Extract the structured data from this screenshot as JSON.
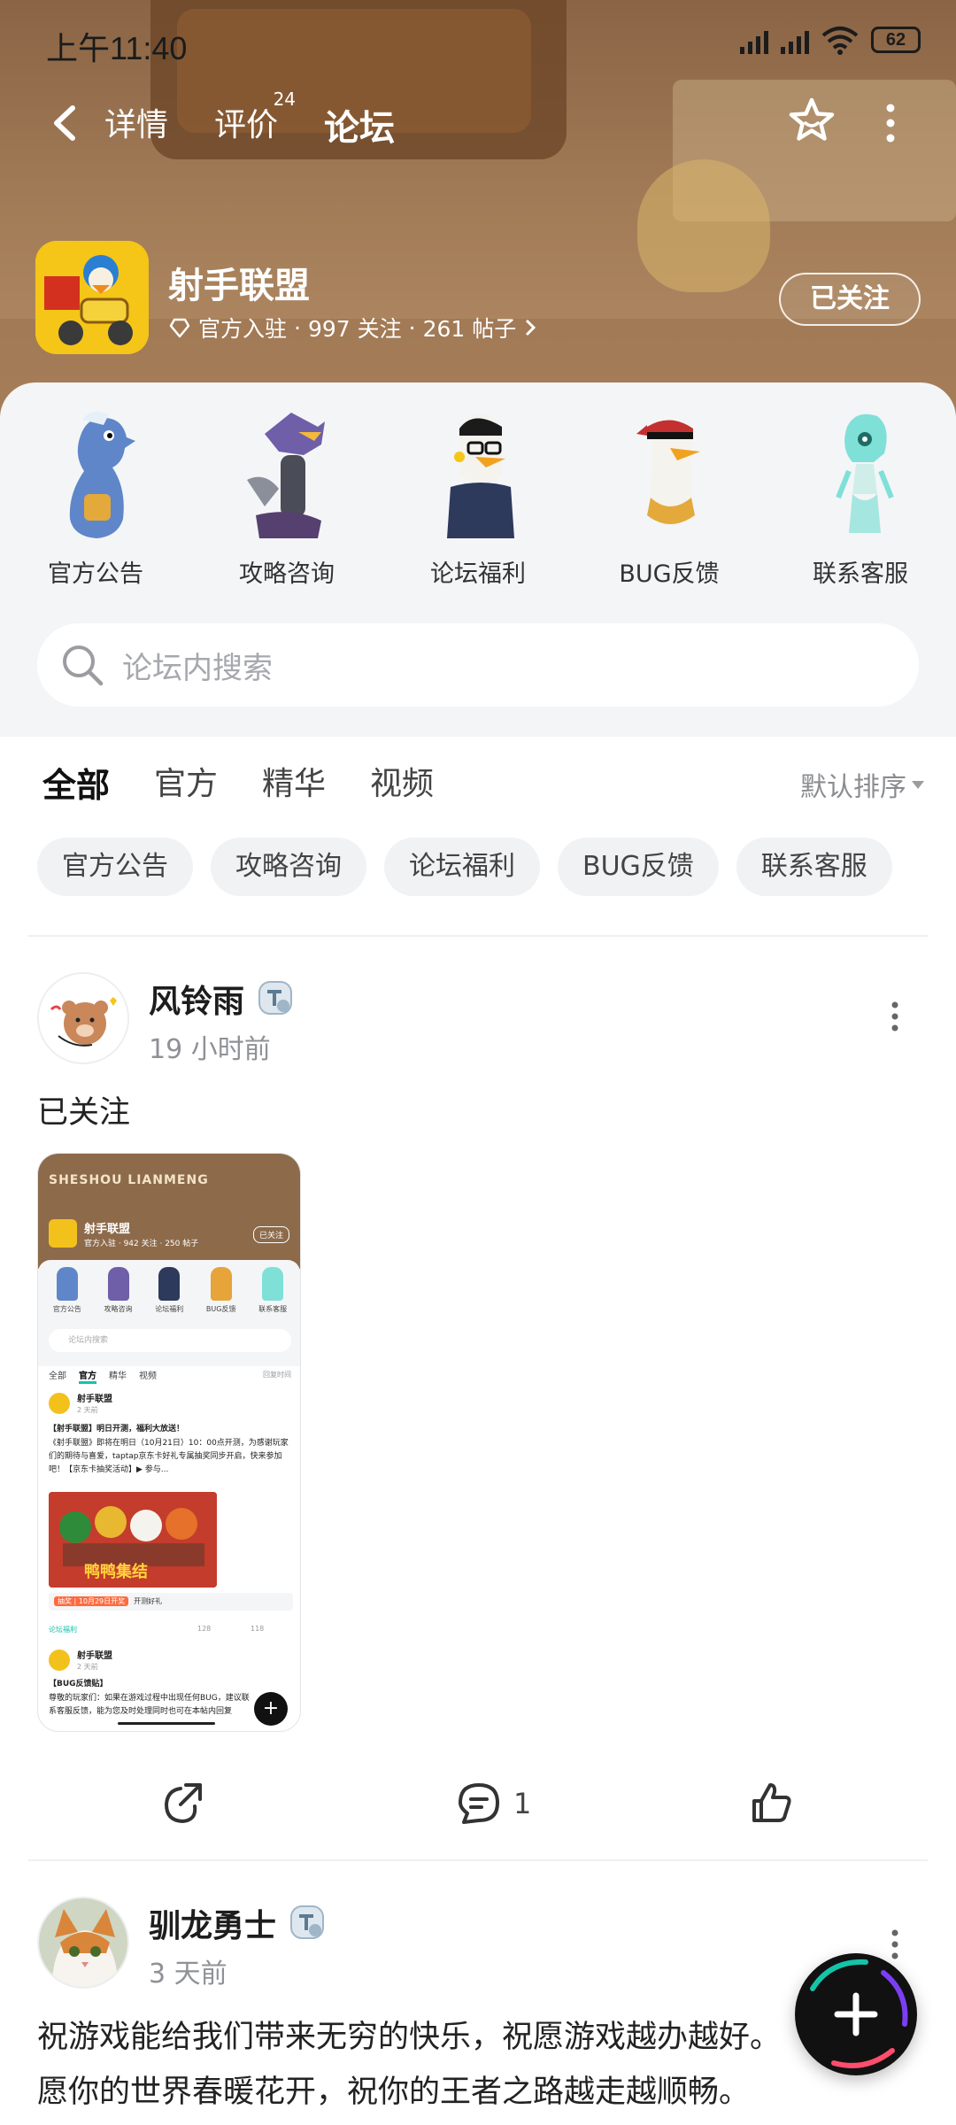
{
  "status_bar": {
    "time": "上午11:40",
    "battery": "62"
  },
  "nav": {
    "tabs": [
      {
        "label": "详情"
      },
      {
        "label": "评价",
        "badge": "24"
      },
      {
        "label": "论坛"
      }
    ],
    "active_tab": "论坛"
  },
  "app": {
    "name": "射手联盟",
    "meta_official": "官方入驻",
    "meta_followers": "997 关注",
    "meta_posts": "261 帖子",
    "separator": "·",
    "follow_label": "已关注"
  },
  "categories": [
    {
      "label": "官方公告",
      "color": "#5f86c9"
    },
    {
      "label": "攻略咨询",
      "color": "#6f5ea8"
    },
    {
      "label": "论坛福利",
      "color": "#2e3a5c"
    },
    {
      "label": "BUG反馈",
      "color": "#c43030"
    },
    {
      "label": "联系客服",
      "color": "#7fe0d8"
    }
  ],
  "search": {
    "placeholder": "论坛内搜索"
  },
  "filter_tabs": [
    "全部",
    "官方",
    "精华",
    "视频"
  ],
  "sort_label": "默认排序",
  "chips": [
    "官方公告",
    "攻略咨询",
    "论坛福利",
    "BUG反馈",
    "联系客服"
  ],
  "posts": [
    {
      "user": "风铃雨",
      "time": "19 小时前",
      "text": "已关注",
      "comments": "1",
      "screenshot": {
        "title": "SHESHOU LIANMENG",
        "app_name": "射手联盟",
        "meta": "官方入驻 · 942 关注 · 250 帖子",
        "follow": "已关注",
        "cats": [
          "官方公告",
          "攻略咨询",
          "论坛福利",
          "BUG反馈",
          "联系客服"
        ],
        "search": "论坛内搜索",
        "tabs": [
          "全部",
          "官方",
          "精华",
          "视频"
        ],
        "sort": "回复时间",
        "post1_user": "射手联盟",
        "post1_date": "2 天前",
        "post1_title": "【射手联盟】明日开测，福利大放送！",
        "post1_body": "《射手联盟》即将在明日（10月21日）10：00点开测，为感谢玩家们的期待与喜爱，taptap京东卡好礼专属抽奖同步开启，快来参加吧！【京东卡抽奖活动】▶ 参与...",
        "post1_img_title": "鸭鸭集结",
        "post1_event_tag": "抽奖 | 10月29日开奖",
        "post1_event_text": "开测好礼",
        "post1_cat": "论坛福利",
        "post1_comments": "128",
        "post1_likes": "118",
        "post2_user": "射手联盟",
        "post2_date": "2 天前",
        "post2_title": "【BUG反馈贴】",
        "post2_body": "尊敬的玩家们：如果在游戏过程中出现任何BUG，建议联系客服反馈，能为您及时处理同时也可在本帖内回复"
      }
    },
    {
      "user": "驯龙勇士",
      "time": "3 天前",
      "text_line1": "祝游戏能给我们带来无穷的快乐，祝愿游戏越办越好。",
      "text_line2": "愿你的世界春暖花开，祝你的王者之路越走越顺畅。"
    }
  ],
  "colors": {
    "accent": "#14c4a8",
    "header_brown": "#a07a56"
  },
  "icons": [
    "back-icon",
    "star-icon",
    "more-icon",
    "heart-shield-icon",
    "chevron-right-icon",
    "search-icon",
    "share-icon",
    "comment-icon",
    "like-icon",
    "plus-icon"
  ]
}
